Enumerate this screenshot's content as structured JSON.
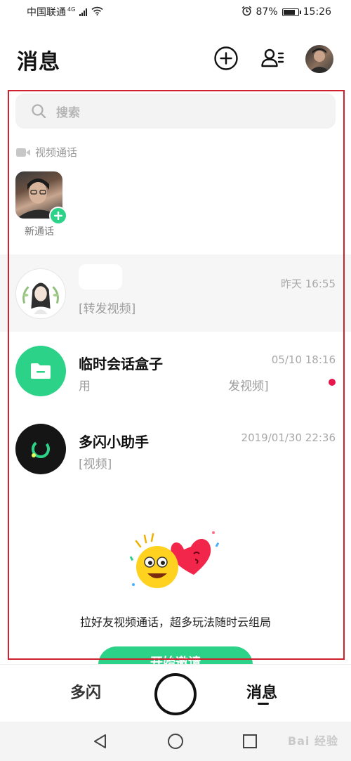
{
  "status_bar": {
    "carrier": "中国联通",
    "network": "4G",
    "battery": "87%",
    "battery_level": 0.87,
    "time": "15:26"
  },
  "header": {
    "title": "消息",
    "icons": [
      "plus-circle-icon",
      "contacts-icon",
      "avatar"
    ]
  },
  "search": {
    "placeholder": "搜索"
  },
  "video_call": {
    "section_label": "视频通话",
    "new_call_label": "新通话"
  },
  "conversations": [
    {
      "name": "",
      "time": "昨天 16:55",
      "preview": "[转发视频]",
      "unread": false,
      "avatar": "girl-illustration"
    },
    {
      "name": "临时会话盒子",
      "time": "05/10 18:16",
      "preview_start": "用",
      "preview_end": "发视频]",
      "unread": true,
      "avatar": "folder-icon"
    },
    {
      "name": "多闪小助手",
      "time": "2019/01/30 22:36",
      "preview": "[视频]",
      "unread": false,
      "avatar": "duoshan-logo-icon"
    }
  ],
  "promo": {
    "text": "拉好友视频通话，超多玩法随时云组局",
    "button_label": "开始邀请"
  },
  "bottom_nav": {
    "left_tab": "多闪",
    "right_tab": "消息",
    "active": "消息"
  },
  "watermark": "Bai 经验"
}
